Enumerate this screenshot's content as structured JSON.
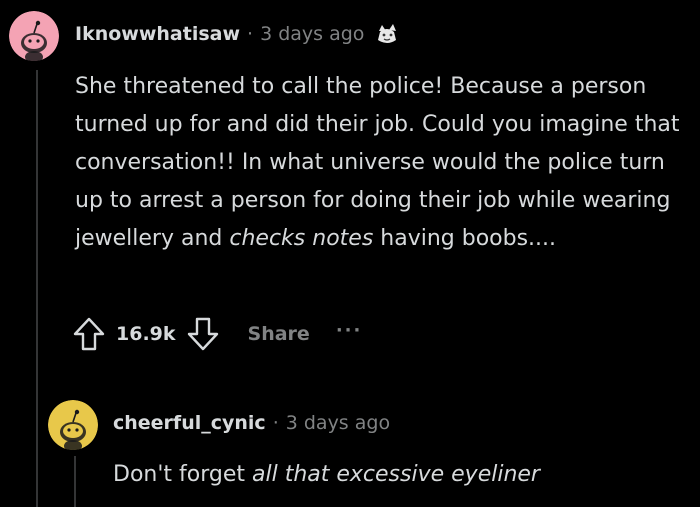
{
  "comment": {
    "username": "Iknowwhatisaw",
    "separator": "·",
    "time": "3 days ago",
    "avatar_color": "#f4a3b4",
    "award_icon": "wholesome-award-icon",
    "body_part1": "She threatened to call the police! Because a person turned up for and did their job. Could you imagine that conversation!! In what universe would the police turn up to arrest a person for doing their job while wearing jewellery and ",
    "body_emphasis": "checks notes",
    "body_part2": " having boobs....",
    "upvote_icon": "upvote-arrow-icon",
    "score": "16.9k",
    "downvote_icon": "downvote-arrow-icon",
    "share_label": "Share",
    "more_label": "···"
  },
  "reply": {
    "username": "cheerful_cynic",
    "separator": "·",
    "time": "3 days ago",
    "avatar_color": "#e8c84a",
    "body_part1": "Don't forget ",
    "body_emphasis": "all that excessive eyeliner"
  },
  "colors": {
    "background": "#000000",
    "text": "#d7dadc",
    "muted": "#818384",
    "thread_line": "#343536"
  }
}
